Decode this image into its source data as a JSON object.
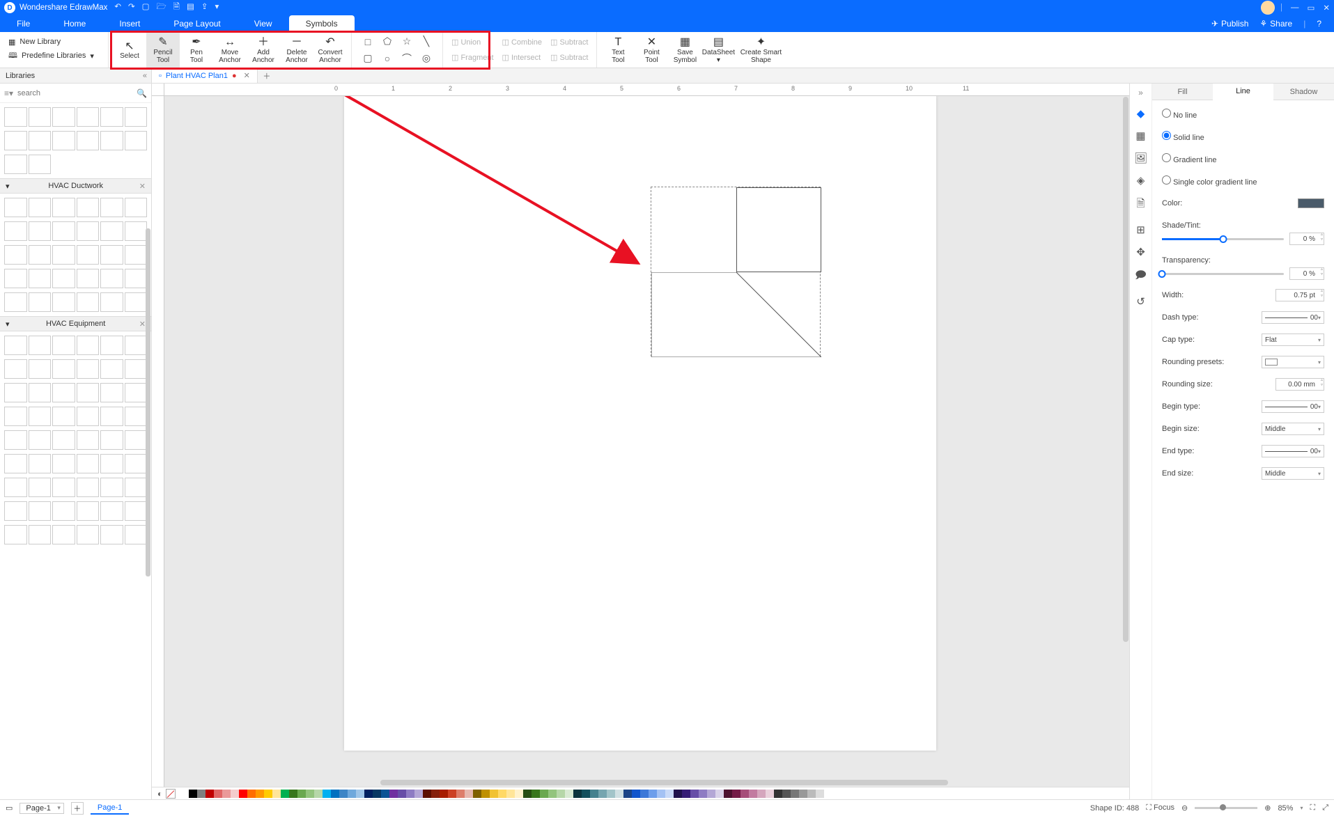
{
  "app": {
    "title": "Wondershare EdrawMax"
  },
  "titlebar": {
    "qat_icons": [
      "undo-icon",
      "redo-icon",
      "new-icon",
      "open-icon",
      "save-icon",
      "print-icon",
      "export-icon",
      "more-icon"
    ]
  },
  "header_actions": {
    "publish": "Publish",
    "share": "Share"
  },
  "menu": {
    "items": [
      "File",
      "Home",
      "Insert",
      "Page Layout",
      "View",
      "Symbols"
    ],
    "active": "Symbols"
  },
  "ribbon": {
    "left": {
      "new_library": "New Library",
      "predefine": "Predefine Libraries"
    },
    "tools": [
      {
        "id": "select",
        "label": "Select",
        "icon": "↖"
      },
      {
        "id": "pencil",
        "label": "Pencil Tool",
        "icon": "✎",
        "active": true
      },
      {
        "id": "pen",
        "label": "Pen Tool",
        "icon": "✒"
      },
      {
        "id": "move-anchor",
        "label": "Move Anchor",
        "icon": "↔"
      },
      {
        "id": "add-anchor",
        "label": "Add Anchor",
        "icon": "＋"
      },
      {
        "id": "delete-anchor",
        "label": "Delete Anchor",
        "icon": "－"
      },
      {
        "id": "convert-anchor",
        "label": "Convert Anchor",
        "icon": "↶"
      }
    ],
    "shapes_grid": [
      "□",
      "⬠",
      "☆",
      "╲",
      "▢",
      "○",
      "⌒",
      "◎"
    ],
    "booleans": [
      "Union",
      "Combine",
      "Subtract",
      "Fragment",
      "Intersect",
      "Subtract"
    ],
    "right_tools": [
      {
        "id": "text-tool",
        "label": "Text Tool",
        "icon": "T"
      },
      {
        "id": "point-tool",
        "label": "Point Tool",
        "icon": "✕"
      },
      {
        "id": "save-symbol",
        "label": "Save Symbol",
        "icon": "▦"
      },
      {
        "id": "datasheet",
        "label": "DataSheet",
        "icon": "▤"
      },
      {
        "id": "smart-shape",
        "label": "Create Smart Shape",
        "icon": "✦"
      }
    ]
  },
  "doc_tab": {
    "libraries_label": "Libraries",
    "name": "Plant HVAC Plan1",
    "modified": "●"
  },
  "lib": {
    "search_placeholder": "search",
    "sections": [
      "HVAC Ductwork",
      "HVAC Equipment"
    ]
  },
  "ruler_ticks": [
    "0",
    "1",
    "2",
    "3",
    "4",
    "5",
    "6",
    "7",
    "8",
    "9",
    "10",
    "11"
  ],
  "side_icons": [
    "style-icon",
    "layout-icon",
    "image-icon",
    "layers-icon",
    "page-icon",
    "align-icon",
    "focus-icon",
    "comment-icon",
    "history-icon"
  ],
  "props": {
    "tabs": [
      "Fill",
      "Line",
      "Shadow"
    ],
    "active_tab": "Line",
    "line_type": {
      "no_line": "No line",
      "solid": "Solid line",
      "gradient": "Gradient line",
      "single_gradient": "Single color gradient line",
      "selected": "solid"
    },
    "labels": {
      "color": "Color:",
      "shade": "Shade/Tint:",
      "transparency": "Transparency:",
      "width": "Width:",
      "dash": "Dash type:",
      "cap": "Cap type:",
      "round_preset": "Rounding presets:",
      "round_size": "Rounding size:",
      "begin_type": "Begin type:",
      "begin_size": "Begin size:",
      "end_type": "End type:",
      "end_size": "End size:"
    },
    "values": {
      "shade": "0 %",
      "transparency": "0 %",
      "width": "0.75 pt",
      "dash": "00",
      "cap": "Flat",
      "round_size": "0.00 mm",
      "begin_type": "00",
      "begin_size": "Middle",
      "end_type": "00",
      "end_size": "Middle"
    }
  },
  "status": {
    "page_selector": "Page-1",
    "page_tab": "Page-1",
    "shape_id_label": "Shape ID:",
    "shape_id": "488",
    "focus": "Focus",
    "zoom": "85%"
  },
  "palette": [
    "#fff",
    "#000",
    "#7f7f7f",
    "#c00000",
    "#e06666",
    "#ea9999",
    "#f4cccc",
    "#ff0000",
    "#ff6d01",
    "#ff9900",
    "#ffcb00",
    "#ffe599",
    "#00b050",
    "#38761d",
    "#6aa84f",
    "#93c47d",
    "#b6d7a8",
    "#00b0f0",
    "#0070c0",
    "#3d85c6",
    "#6fa8dc",
    "#9fc5e8",
    "#002060",
    "#073763",
    "#0b5394",
    "#7030a0",
    "#674ea7",
    "#8e7cc3",
    "#b4a7d6",
    "#5b0f00",
    "#85200c",
    "#a61c00",
    "#cc4125",
    "#dd7e6b",
    "#e6b8af",
    "#7f6000",
    "#bf9000",
    "#f1c232",
    "#ffd966",
    "#ffe599",
    "#fff2cc",
    "#274e13",
    "#38761d",
    "#6aa84f",
    "#93c47d",
    "#b6d7a8",
    "#d9ead3",
    "#0c343d",
    "#134f5c",
    "#45818e",
    "#76a5af",
    "#a2c4c9",
    "#d0e0e3",
    "#1c4587",
    "#1155cc",
    "#3c78d8",
    "#6d9eeb",
    "#a4c2f4",
    "#c9daf8",
    "#20124d",
    "#351c75",
    "#674ea7",
    "#8e7cc3",
    "#b4a7d6",
    "#d9d2e9",
    "#4c1130",
    "#741b47",
    "#a64d79",
    "#c27ba0",
    "#d5a6bd",
    "#ead1dc",
    "#333333",
    "#555555",
    "#777777",
    "#999999",
    "#bbbbbb",
    "#dddddd"
  ]
}
